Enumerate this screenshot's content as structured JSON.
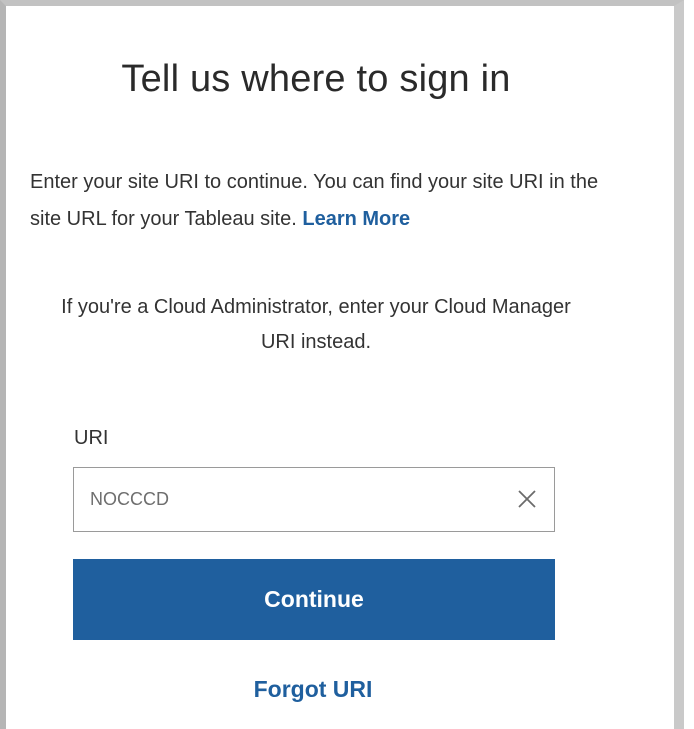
{
  "dialog": {
    "title": "Tell us where to sign in",
    "intro_text": "Enter your site URI to continue. You can find your site URI in the site URL for your Tableau site.",
    "learn_more_label": "Learn More",
    "admin_note": "If you're a Cloud Administrator, enter your Cloud Manager URI instead."
  },
  "uri_field": {
    "label": "URI",
    "value": "NOCCCD",
    "clear_icon": "close-icon"
  },
  "actions": {
    "continue_label": "Continue",
    "forgot_label": "Forgot URI"
  },
  "colors": {
    "accent": "#1f5f9e",
    "text": "#333333",
    "field_border": "#9a9a9a"
  }
}
